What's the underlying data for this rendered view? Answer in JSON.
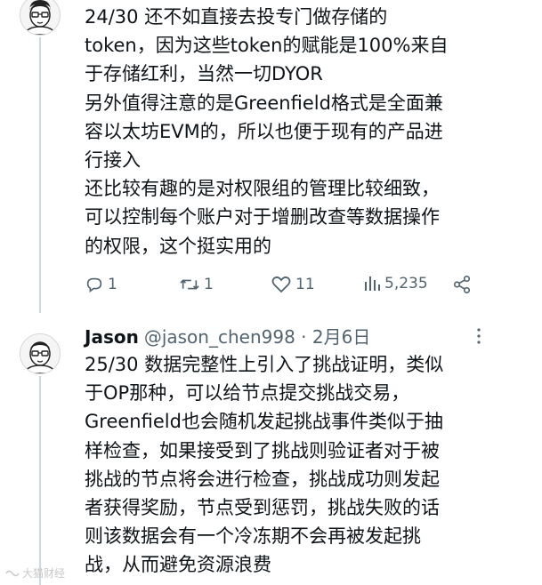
{
  "tweet1": {
    "author_avatar": "avatar-glasses-man",
    "text": "24/30 还不如直接去投专门做存储的\ntoken，因为这些token的赋能是100%来自\n于存储红利，当然一切DYOR\n另外值得注意的是Greenfield格式是全面兼\n容以太坊EVM的，所以也便于现有的产品进\n行接入\n还比较有趣的是对权限组的管理比较细致，\n可以控制每个账户对于增删改查等数据操作\n的权限，这个挺实用的",
    "actions": {
      "reply_count": "1",
      "retweet_count": "1",
      "like_count": "11",
      "view_count": "5,235"
    }
  },
  "tweet2": {
    "author_avatar": "avatar-glasses-man",
    "name": "Jason",
    "handle_date": "@jason_chen998 · 2月6日",
    "text": "25/30 数据完整性上引入了挑战证明，类似\n于OP那种，可以给节点提交挑战交易，\nGreenfield也会随机发起挑战事件类似于抽\n样检查，如果接受到了挑战则验证者对于被\n挑战的节点将会进行检查，挑战成功则发起\n者获得奖励，节点受到惩罚，挑战失败的话\n则该数据会有一个冷冻期不会再被发起挑\n战，从而避免资源浪费"
  },
  "watermark": "大猫财经",
  "colors": {
    "text": "#0f1419",
    "muted": "#536471",
    "line": "#cfd9de"
  }
}
